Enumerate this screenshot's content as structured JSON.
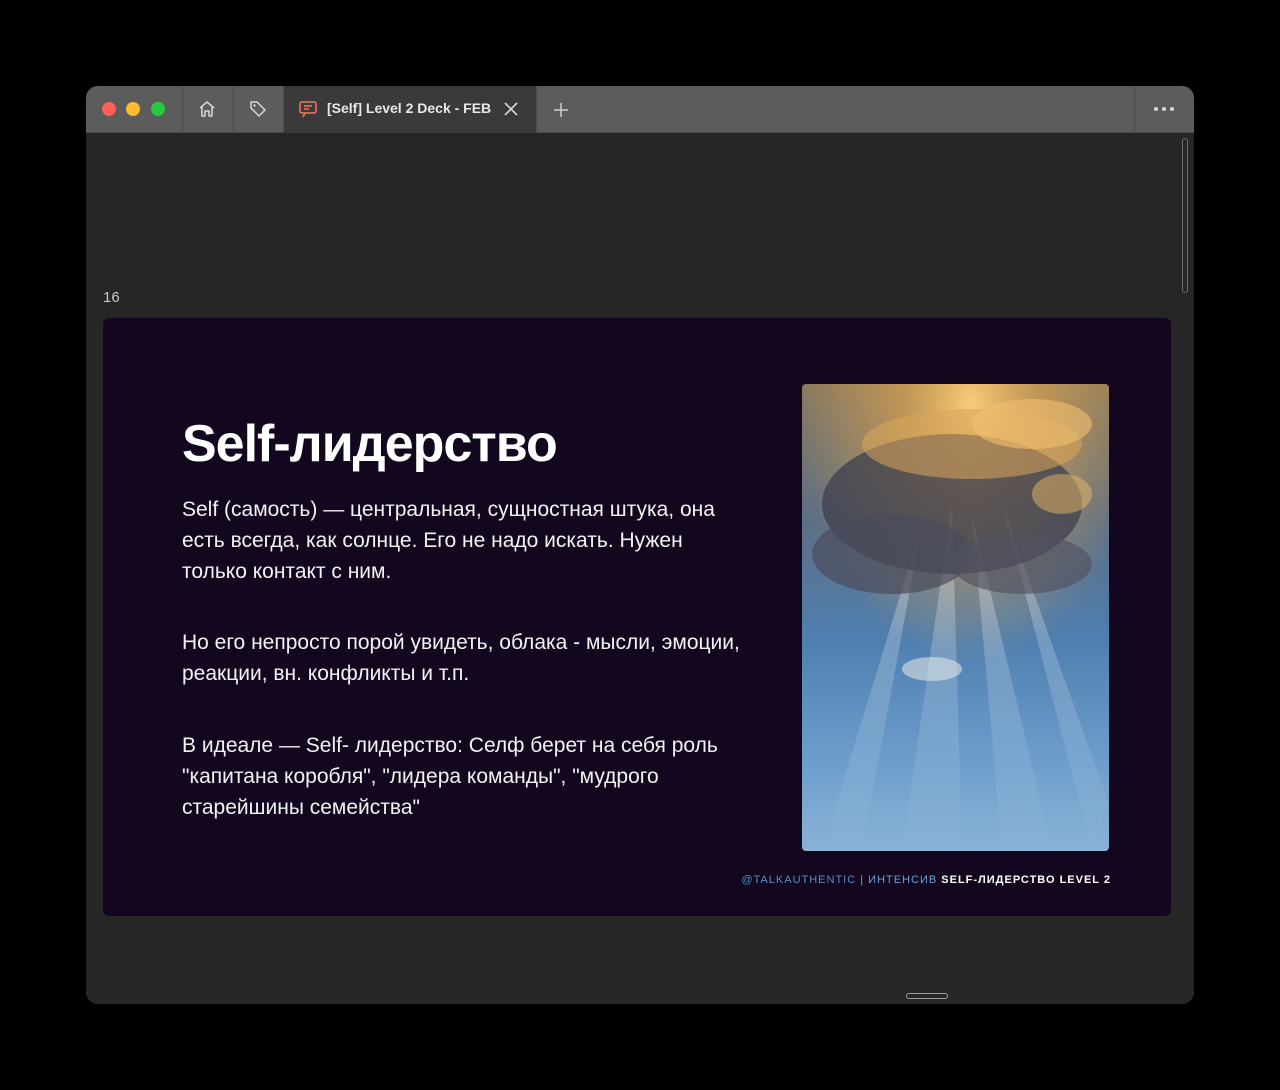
{
  "window": {
    "tab": {
      "title": "[Self] Level 2 Deck - FEB",
      "icon": "presentation-icon"
    },
    "toolbar_icons": [
      "home-icon",
      "tag-icon",
      "plus-icon",
      "more-icon",
      "close-icon"
    ]
  },
  "colors": {
    "slide_bg": "#12071f",
    "footer_handle": "#5c8bb9",
    "accent_icon": "#f07a5a"
  },
  "viewer": {
    "page_number": "16"
  },
  "slide": {
    "title": "Self-лидерство",
    "paragraphs": [
      "Self (самость) — центральная, сущностная штука, она есть всегда, как солнце. Его не надо искать. Нужен только контакт с ним.",
      "Но его непросто порой увидеть, облака - мысли, эмоции, реакции, вн. конфликты и т.п.",
      "В идеале — Self- лидерство: Селф берет на себя роль \"капитана коробля\", \"лидера команды\", \"мудрого старейшины семейства\""
    ],
    "footer": {
      "handle": "@TALKAUTHENTIC",
      "separator": "| ИНТЕНСИВ",
      "course": "SELF-ЛИДЕРСТВО LEVEL 2"
    }
  }
}
